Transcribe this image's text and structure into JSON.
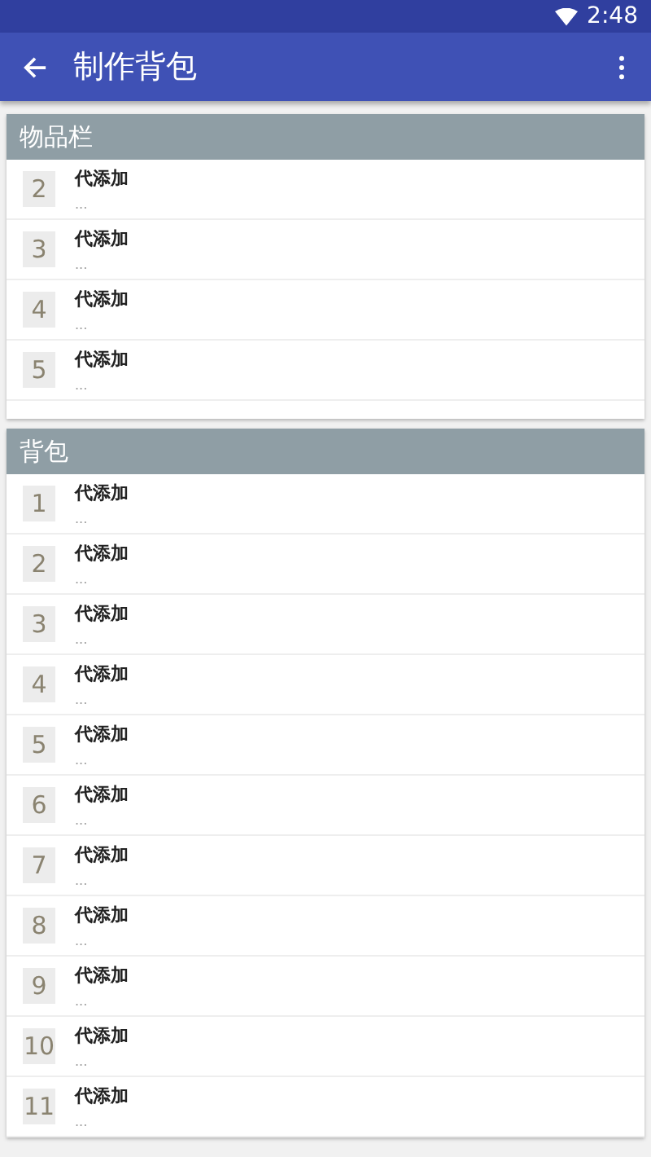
{
  "status_bar": {
    "time": "2:48"
  },
  "app_bar": {
    "title": "制作背包"
  },
  "sections": [
    {
      "title": "物品栏",
      "items": [
        {
          "number": "2",
          "title": "代添加",
          "subtitle": "..."
        },
        {
          "number": "3",
          "title": "代添加",
          "subtitle": "..."
        },
        {
          "number": "4",
          "title": "代添加",
          "subtitle": "..."
        },
        {
          "number": "5",
          "title": "代添加",
          "subtitle": "..."
        }
      ]
    },
    {
      "title": "背包",
      "items": [
        {
          "number": "1",
          "title": "代添加",
          "subtitle": "..."
        },
        {
          "number": "2",
          "title": "代添加",
          "subtitle": "..."
        },
        {
          "number": "3",
          "title": "代添加",
          "subtitle": "..."
        },
        {
          "number": "4",
          "title": "代添加",
          "subtitle": "..."
        },
        {
          "number": "5",
          "title": "代添加",
          "subtitle": "..."
        },
        {
          "number": "6",
          "title": "代添加",
          "subtitle": "..."
        },
        {
          "number": "7",
          "title": "代添加",
          "subtitle": "..."
        },
        {
          "number": "8",
          "title": "代添加",
          "subtitle": "..."
        },
        {
          "number": "9",
          "title": "代添加",
          "subtitle": "..."
        },
        {
          "number": "10",
          "title": "代添加",
          "subtitle": "..."
        },
        {
          "number": "11",
          "title": "代添加",
          "subtitle": "..."
        }
      ]
    }
  ]
}
